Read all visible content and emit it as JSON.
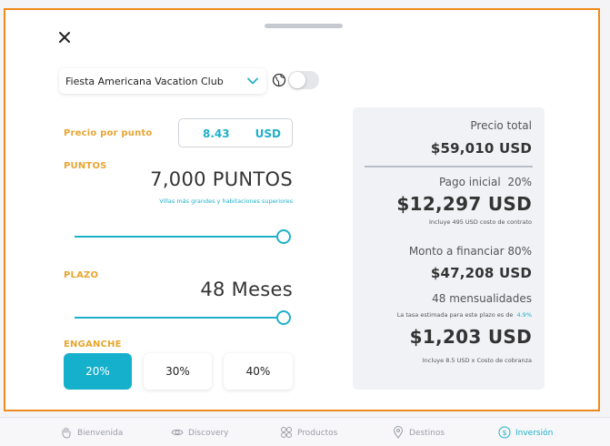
{
  "club": {
    "selected": "Fiesta Americana Vacation Club"
  },
  "left": {
    "price_label": "Precio por punto",
    "price_value": "8.43",
    "price_currency": "USD",
    "points_label": "PUNTOS",
    "points_value": "7,000 PUNTOS",
    "points_note": "Villas más grandes y habitaciones superiores",
    "points_slider_level": 1.0,
    "term_label": "PLAZO",
    "term_value": "48 Meses",
    "term_slider_level": 1.0,
    "down_label": "ENGANCHE",
    "down_options": [
      "20%",
      "30%",
      "40%"
    ],
    "down_selected": "20%"
  },
  "summary": {
    "total_label": "Precio total",
    "total_value": "$59,010 USD",
    "initial_label": "Pago inicial",
    "initial_pct": "20%",
    "initial_value": "$12,297 USD",
    "initial_note": "Incluye  495 USD costo de contrato",
    "finance_label": "Monto a financiar 80%",
    "finance_value": "$47,208 USD",
    "months_label": "48 mensualidades",
    "rate_note": "La tasa estimada para este plazo es de",
    "rate_value": "4.9%",
    "monthly_value": "$1,203 USD",
    "monthly_note": "Incluye 8.5 USD x Costo de cobranza"
  },
  "tabs": [
    {
      "label": "Bienvenida",
      "icon": "hand-icon"
    },
    {
      "label": "Discovery",
      "icon": "eye-icon"
    },
    {
      "label": "Productos",
      "icon": "grid-icon"
    },
    {
      "label": "Destinos",
      "icon": "map-pin-icon"
    },
    {
      "label": "Inversión",
      "icon": "dollar-icon",
      "active": true
    }
  ],
  "colors": {
    "accent": "#1fb0c9",
    "label_orange": "#e8a531",
    "frame_orange": "#f08a1c"
  }
}
